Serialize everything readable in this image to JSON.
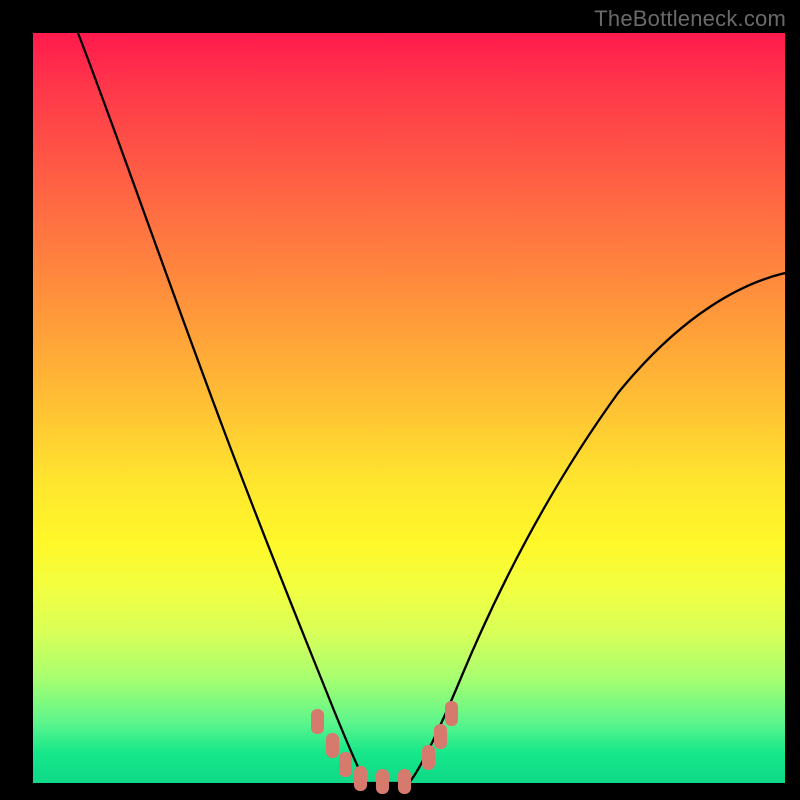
{
  "watermark": "TheBottleneck.com",
  "chart_data": {
    "type": "line",
    "title": "",
    "xlabel": "",
    "ylabel": "",
    "xlim": [
      0,
      100
    ],
    "ylim": [
      0,
      100
    ],
    "grid": false,
    "legend": false,
    "series": [
      {
        "name": "left-curve",
        "color": "#000000",
        "x": [
          6,
          10,
          15,
          20,
          25,
          30,
          34,
          37,
          39,
          41,
          43
        ],
        "y": [
          100,
          86,
          70,
          55,
          40,
          26,
          15,
          8,
          4,
          1,
          0
        ]
      },
      {
        "name": "right-curve",
        "color": "#000000",
        "x": [
          49,
          51,
          54,
          58,
          63,
          70,
          78,
          88,
          100
        ],
        "y": [
          0,
          2,
          7,
          15,
          25,
          38,
          50,
          60,
          68
        ]
      },
      {
        "name": "flat-bottom",
        "color": "#000000",
        "x": [
          43,
          49
        ],
        "y": [
          0,
          0
        ]
      }
    ],
    "markers": {
      "name": "highlighted-points",
      "color": "#d77a6e",
      "shape": "rounded-rect",
      "points": [
        {
          "x": 37.5,
          "y": 8
        },
        {
          "x": 39.5,
          "y": 5
        },
        {
          "x": 41.0,
          "y": 2
        },
        {
          "x": 43.0,
          "y": 0
        },
        {
          "x": 46.0,
          "y": 0
        },
        {
          "x": 49.0,
          "y": 0
        },
        {
          "x": 52.5,
          "y": 4
        },
        {
          "x": 54.0,
          "y": 7
        },
        {
          "x": 55.5,
          "y": 10
        }
      ]
    },
    "background_gradient": {
      "top": "#ff1a4d",
      "upper_mid": "#ff9a3a",
      "mid": "#ffe62e",
      "lower_mid": "#d8ff58",
      "bottom": "#16e78a"
    }
  }
}
